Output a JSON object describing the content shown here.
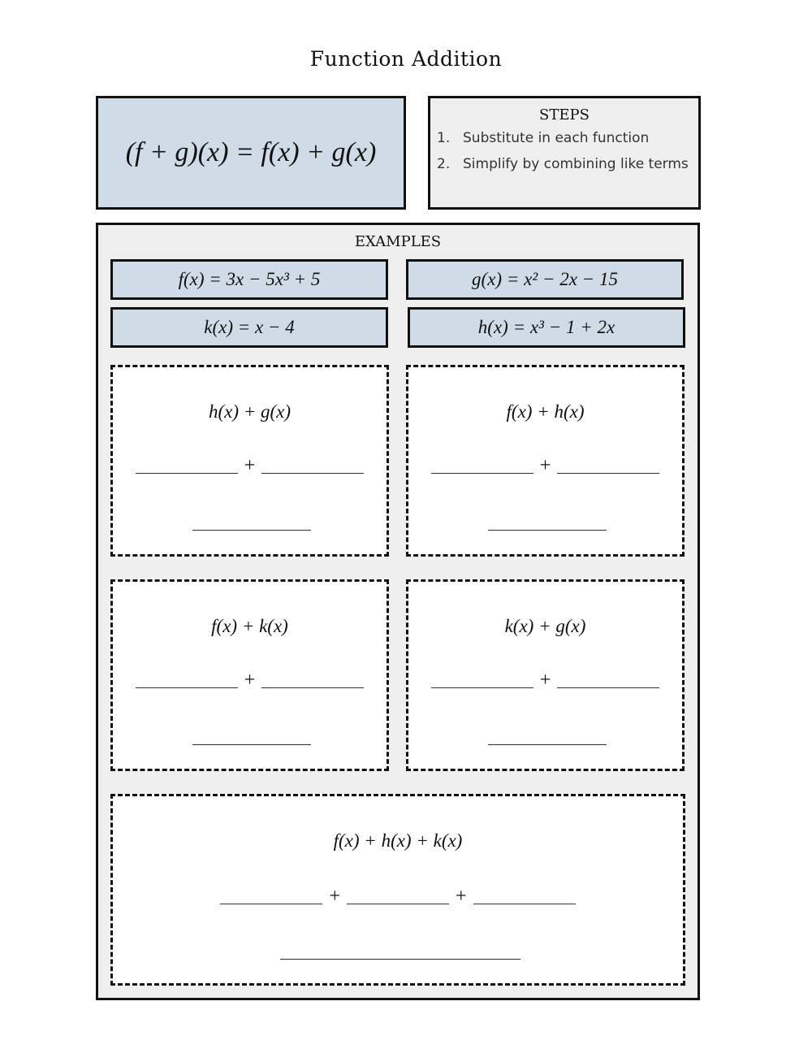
{
  "page_title": "Function Addition",
  "definition": "(f + g)(x) = f(x) + g(x)",
  "steps": {
    "title": "STEPS",
    "items": [
      {
        "num": "1.",
        "text": "Substitute in each function"
      },
      {
        "num": "2.",
        "text": "Simplify by combining like terms"
      }
    ]
  },
  "examples": {
    "title": "EXAMPLES",
    "functions": {
      "f": "f(x) = 3x − 5x³ + 5",
      "g": "g(x) = x² − 2x − 15",
      "k": "k(x) = x − 4",
      "h": "h(x) = x³ − 1 + 2x"
    },
    "problems": [
      {
        "expr": "h(x) + g(x)",
        "plus": "+"
      },
      {
        "expr": "f(x) + h(x)",
        "plus": "+"
      },
      {
        "expr": "f(x) + k(x)",
        "plus": "+"
      },
      {
        "expr": "k(x) + g(x)",
        "plus": "+"
      },
      {
        "expr": "f(x) + h(x) + k(x)",
        "plus": "+"
      }
    ]
  }
}
